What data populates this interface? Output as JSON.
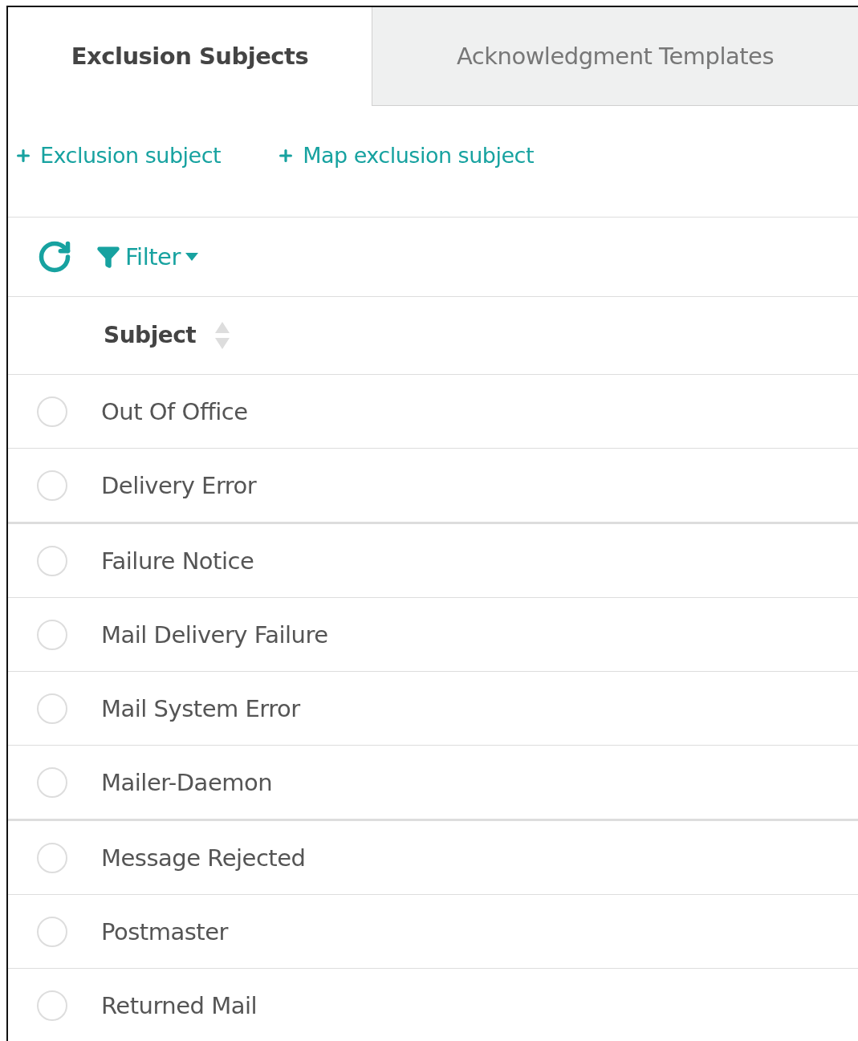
{
  "tabs": [
    {
      "label": "Exclusion Subjects",
      "selected": true
    },
    {
      "label": "Acknowledgment Templates",
      "selected": false
    }
  ],
  "actions": [
    {
      "label": "Exclusion subject"
    },
    {
      "label": "Map exclusion subject"
    }
  ],
  "toolbar": {
    "filter": "Filter"
  },
  "table": {
    "columns": [
      {
        "label": "Subject"
      }
    ],
    "rows": [
      {
        "subject": "Out Of Office",
        "selected": false
      },
      {
        "subject": "Delivery Error",
        "selected": false
      },
      {
        "subject": "Failure Notice",
        "selected": false
      },
      {
        "subject": "Mail Delivery Failure",
        "selected": false
      },
      {
        "subject": "Mail System Error",
        "selected": false
      },
      {
        "subject": "Mailer-Daemon",
        "selected": false
      },
      {
        "subject": "Message Rejected",
        "selected": false
      },
      {
        "subject": "Postmaster",
        "selected": false
      },
      {
        "subject": "Returned Mail",
        "selected": false
      }
    ]
  }
}
